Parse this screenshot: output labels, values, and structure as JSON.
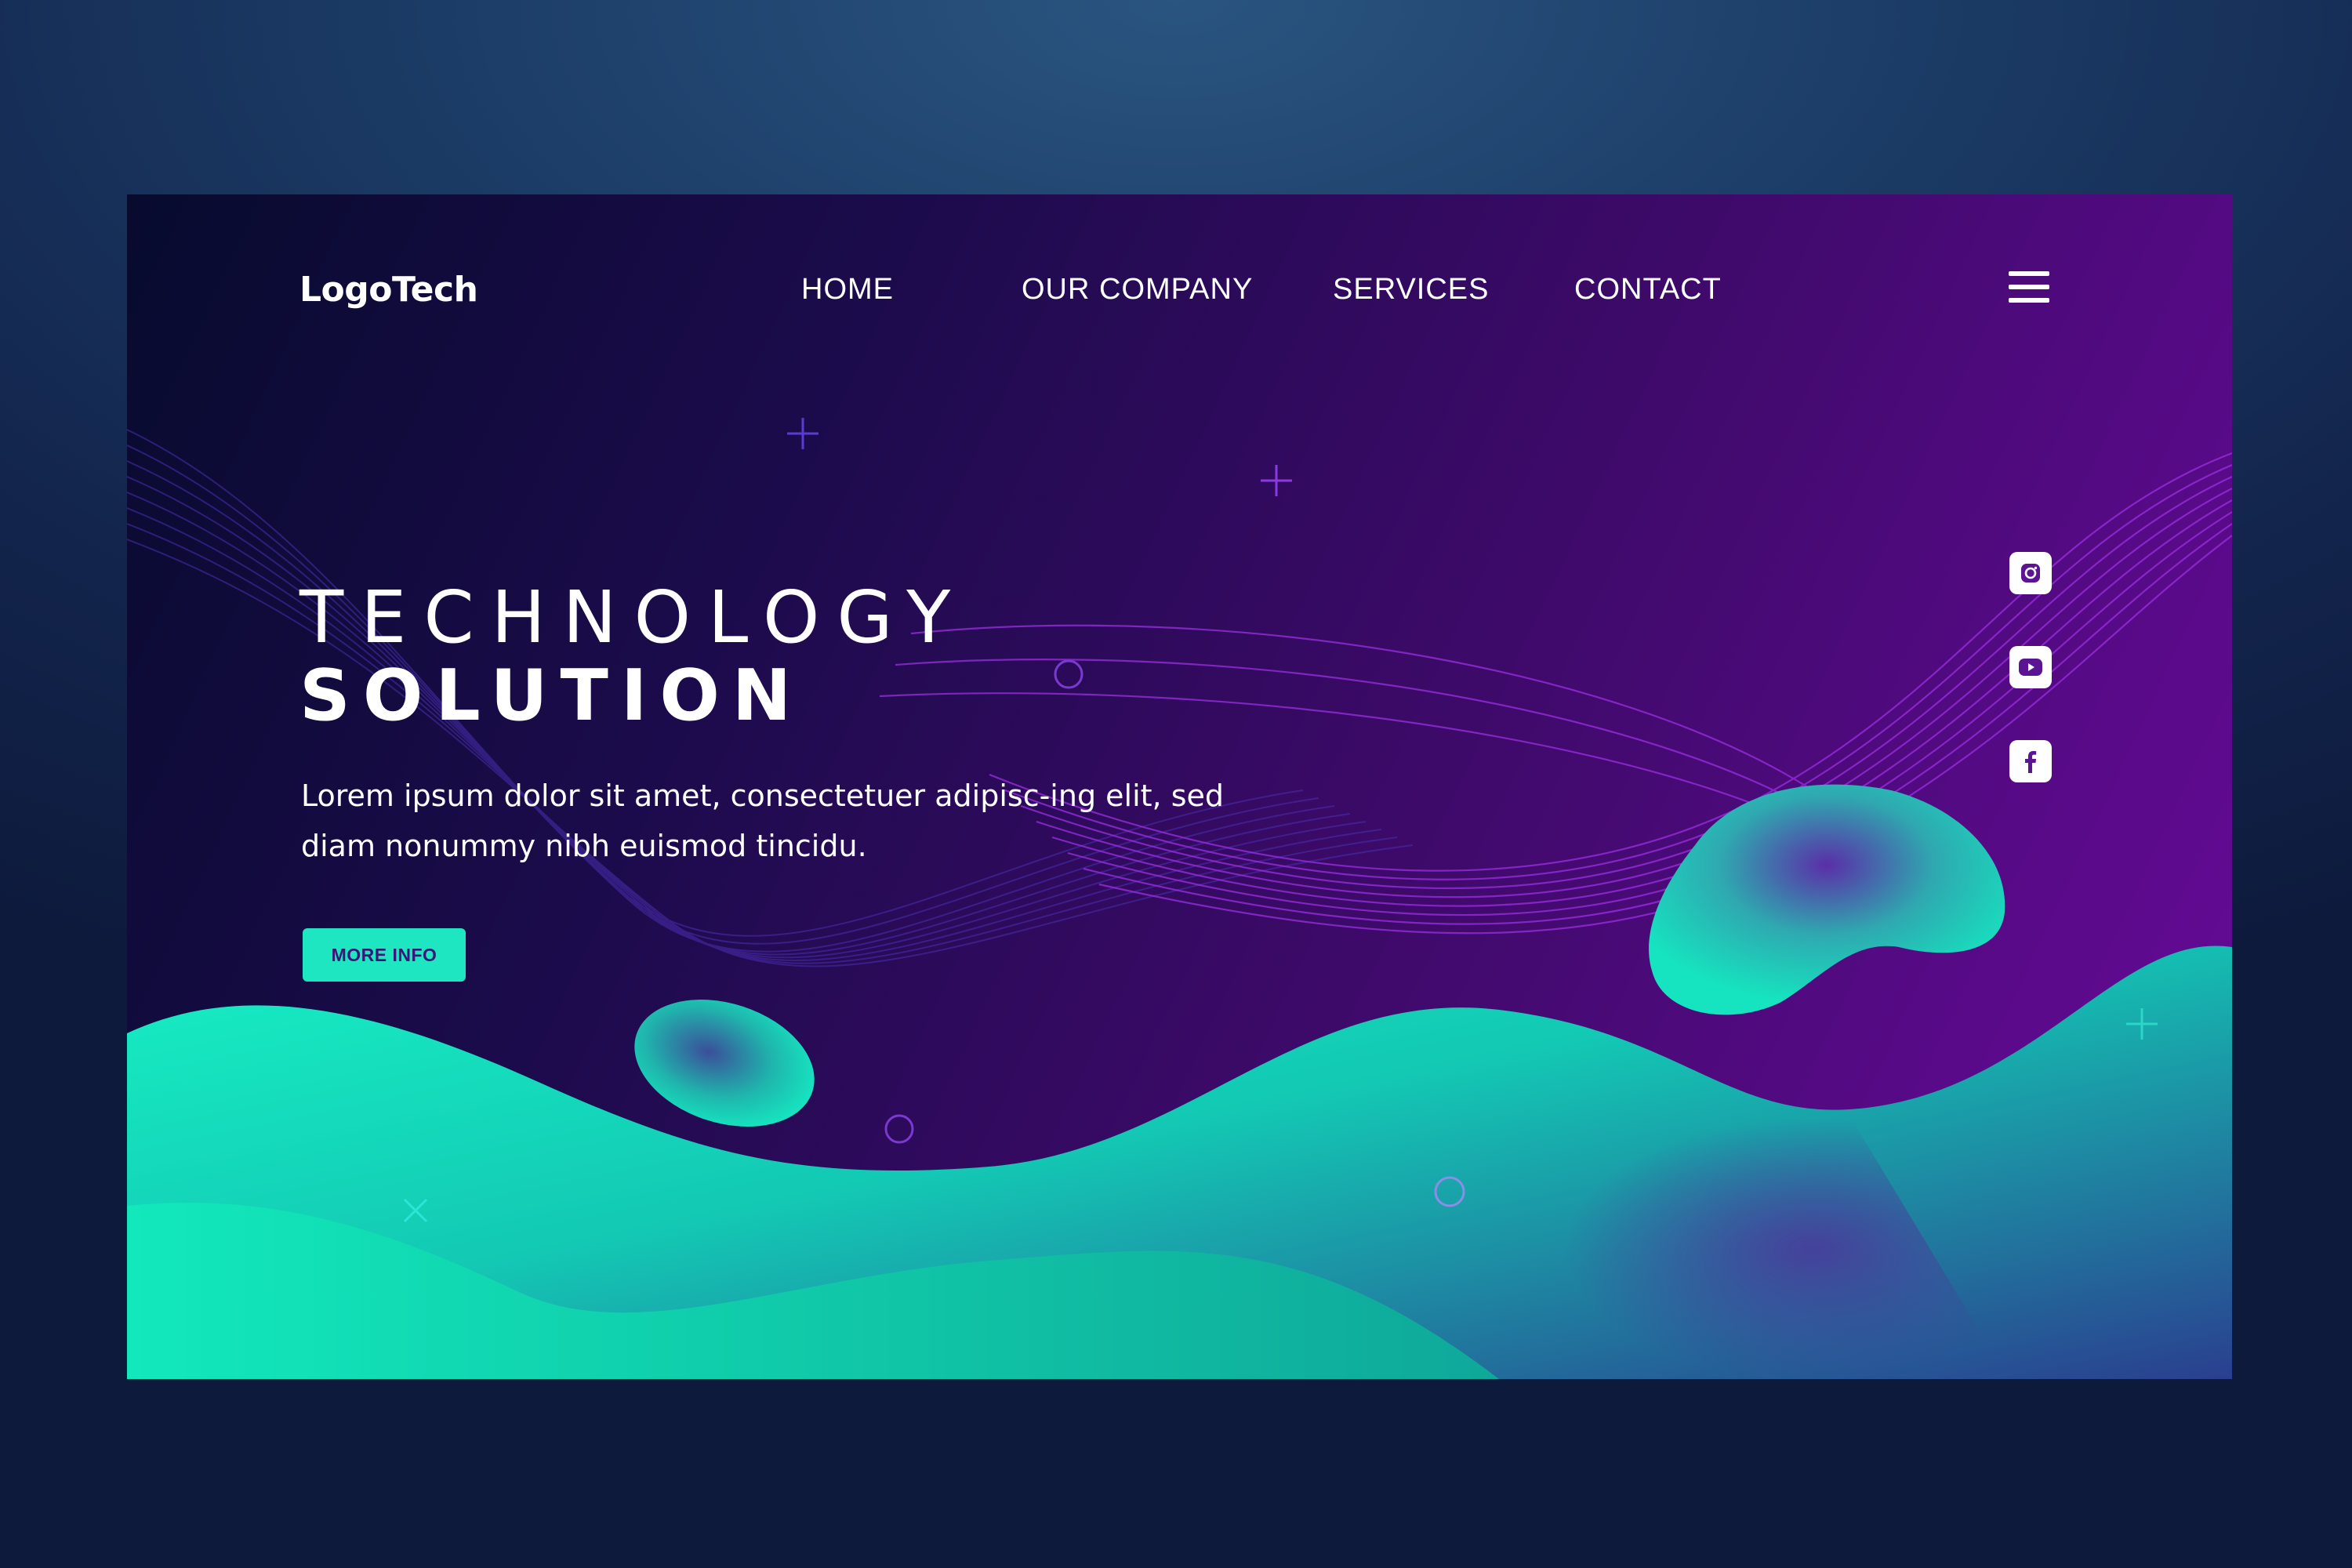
{
  "brand": {
    "logo_text": "LogoTech"
  },
  "nav": {
    "items": [
      {
        "label": "HOME"
      },
      {
        "label": "OUR COMPANY"
      },
      {
        "label": "SERVICES"
      },
      {
        "label": "CONTACT"
      }
    ],
    "menu_icon": "hamburger-menu-icon"
  },
  "hero": {
    "title_light": "TECHNOLOGY",
    "title_bold": "SOLUTION",
    "description": "Lorem ipsum dolor sit amet, consectetuer adipisc-ing elit, sed diam nonummy nibh euismod tincidu.",
    "cta_label": "MORE INFO"
  },
  "social": [
    {
      "icon": "instagram-icon"
    },
    {
      "icon": "youtube-icon"
    },
    {
      "icon": "facebook-icon"
    }
  ],
  "colors": {
    "accent": "#1de6c0",
    "purple_dark": "#1c0b4c",
    "purple_bright": "#6a0a9c",
    "cta_text": "#3b1577"
  }
}
